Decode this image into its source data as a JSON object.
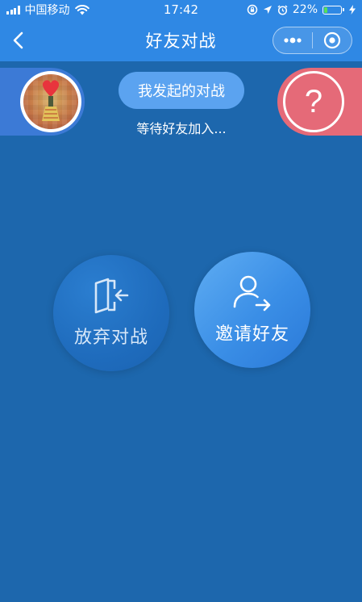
{
  "status_bar": {
    "carrier": "中国移动",
    "time": "17:42",
    "battery_percent": "22%",
    "battery_level": 0.22,
    "icons": [
      "signal-icon",
      "wifi-icon",
      "lock-rotation-icon",
      "location-icon",
      "alarm-icon",
      "battery-icon",
      "charging-icon"
    ]
  },
  "nav": {
    "title": "好友对战",
    "back_icon": "chevron-left-icon",
    "more_icon": "more-dots-icon",
    "close_icon": "target-close-icon"
  },
  "players": {
    "self_avatar": "avatar",
    "opponent_placeholder": "?"
  },
  "battle": {
    "tag": "我发起的对战",
    "status": "等待好友加入..."
  },
  "actions": {
    "quit_label": "放弃对战",
    "quit_icon": "exit-door-icon",
    "invite_label": "邀请好友",
    "invite_icon": "user-share-icon"
  },
  "colors": {
    "background": "#1d67ad",
    "bar": "#2f88e4",
    "left_panel": "#3c7ad6",
    "right_panel": "#e56a78",
    "tag": "#5ba3f0",
    "battery_fill": "#57e157"
  }
}
